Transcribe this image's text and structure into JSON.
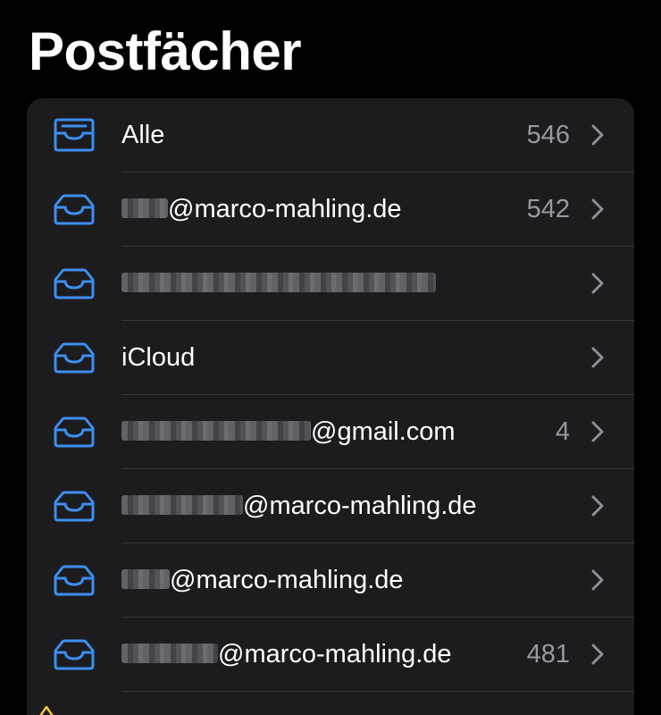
{
  "header": {
    "title": "Postfächer"
  },
  "colors": {
    "accent": "#3d8ef0",
    "background": "#000000",
    "card": "#1c1c1e",
    "secondary_text": "#98989f",
    "warning": "#f5c542"
  },
  "mailboxes": [
    {
      "label": "Alle",
      "count": "546",
      "icon": "inbox-tray-icon"
    },
    {
      "label": "@marco-mahling.de",
      "count": "542",
      "icon": "inbox-tray-icon"
    },
    {
      "label": "",
      "count": "",
      "icon": "inbox-tray-icon"
    },
    {
      "label": "iCloud",
      "count": "",
      "icon": "inbox-tray-icon"
    },
    {
      "label": "@gmail.com",
      "count": "4",
      "icon": "inbox-tray-icon"
    },
    {
      "label": "@marco-mahling.de",
      "count": "",
      "icon": "inbox-tray-icon"
    },
    {
      "label": "@marco-mahling.de",
      "count": "",
      "icon": "inbox-tray-icon"
    },
    {
      "label": "@marco-mahling.de",
      "count": "481",
      "icon": "inbox-tray-icon"
    }
  ]
}
